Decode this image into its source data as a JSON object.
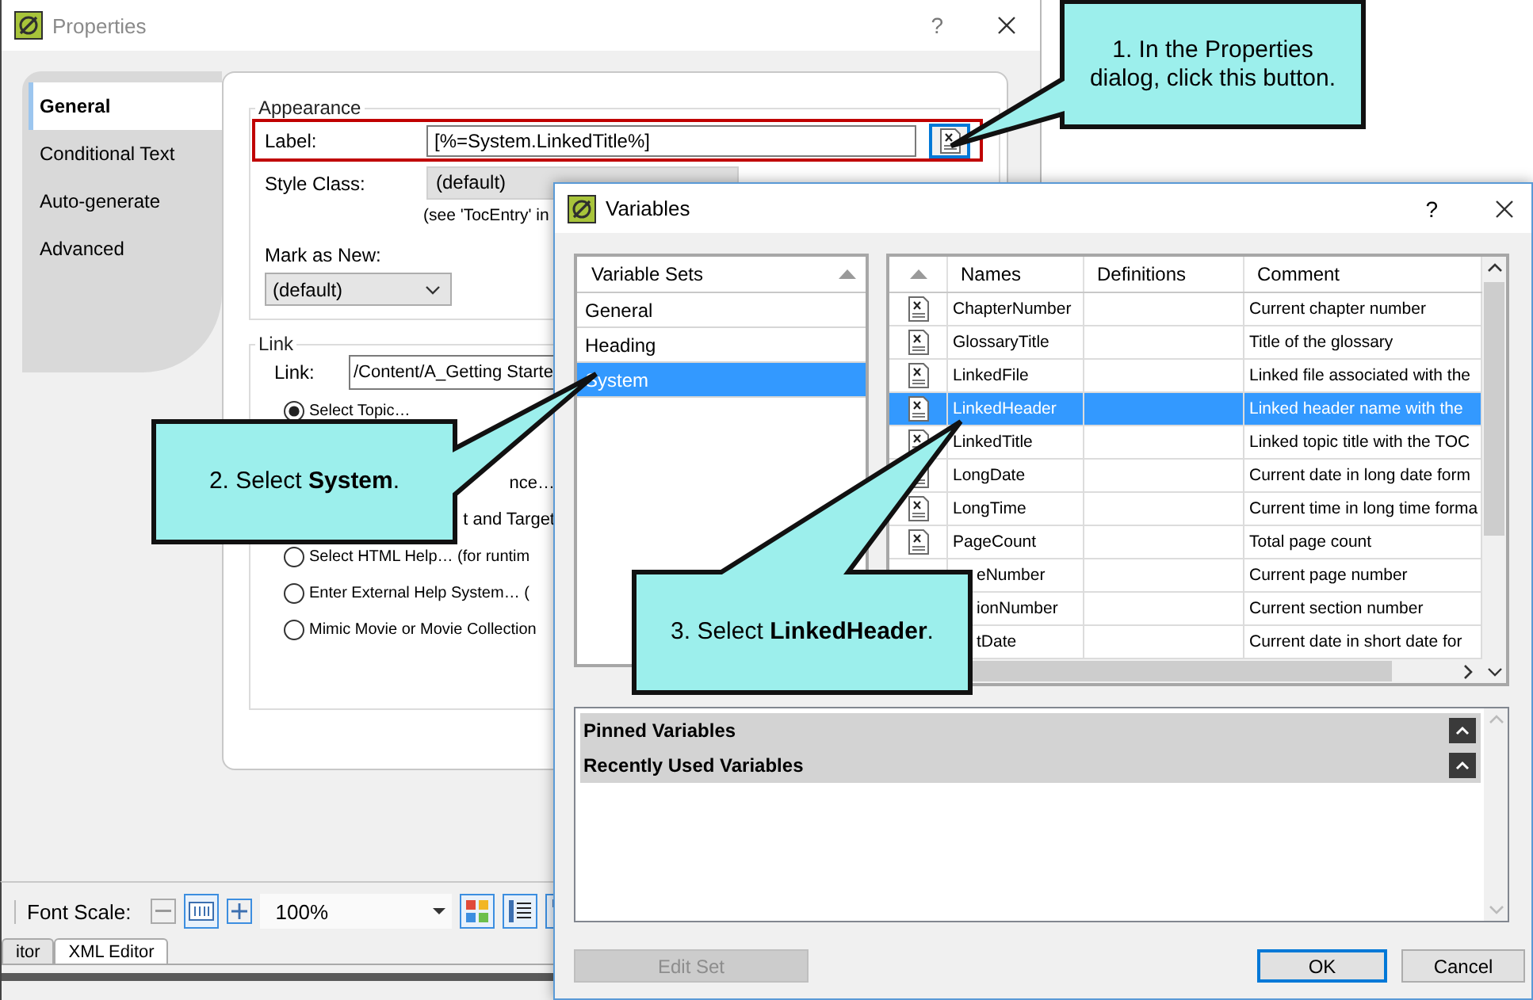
{
  "properties_window": {
    "title": "Properties",
    "help": "?",
    "tabs": [
      {
        "label": "General",
        "selected": true
      },
      {
        "label": "Conditional Text",
        "selected": false
      },
      {
        "label": "Auto-generate",
        "selected": false
      },
      {
        "label": "Advanced",
        "selected": false
      }
    ],
    "appearance": {
      "legend": "Appearance",
      "label": "Label:",
      "label_value": "[%=System.LinkedTitle%]",
      "style_class_label": "Style Class:",
      "style_class_value": "(default)",
      "style_class_note": "(see 'TocEntry' in",
      "mark_as_new_label": "Mark as New:",
      "mark_as_new_value": "(default)"
    },
    "link": {
      "legend": "Link",
      "label": "Link:",
      "value": "/Content/A_Getting Starte",
      "options": [
        {
          "kind": "radio",
          "label": "Select Topic…",
          "selected": true
        },
        {
          "kind": "fragment",
          "label": "nce…"
        },
        {
          "kind": "fragment",
          "label": "t and Target"
        },
        {
          "kind": "radio",
          "label": "Select HTML Help… (for runtim",
          "selected": false
        },
        {
          "kind": "radio",
          "label": "Enter External Help System… (",
          "selected": false
        },
        {
          "kind": "radio",
          "label": "Mimic Movie or Movie Collection",
          "selected": false
        }
      ]
    }
  },
  "editor_toolbar": {
    "font_scale_label": "Font Scale:",
    "zoom_value": "100%",
    "tabs": [
      {
        "label": "itor",
        "selected": false
      },
      {
        "label": "XML Editor",
        "selected": true
      }
    ]
  },
  "variables_window": {
    "title": "Variables",
    "help": "?",
    "sets_header": "Variable Sets",
    "sets": [
      {
        "label": "General",
        "selected": false
      },
      {
        "label": "Heading",
        "selected": false
      },
      {
        "label": "System",
        "selected": true
      }
    ],
    "columns": [
      "Names",
      "Definitions",
      "Comment"
    ],
    "rows": [
      {
        "kind": "full",
        "name": "ChapterNumber",
        "comment": "Current chapter number",
        "selected": false
      },
      {
        "kind": "full",
        "name": "GlossaryTitle",
        "comment": "Title of the glossary",
        "selected": false
      },
      {
        "kind": "full",
        "name": "LinkedFile",
        "comment": "Linked file associated with the",
        "selected": false
      },
      {
        "kind": "full",
        "name": "LinkedHeader",
        "comment": "Linked header name with the",
        "selected": true
      },
      {
        "kind": "full",
        "name": "LinkedTitle",
        "comment": "Linked topic title with the TOC",
        "selected": false
      },
      {
        "kind": "full",
        "name": "LongDate",
        "comment": "Current date in long date form",
        "selected": false
      },
      {
        "kind": "full",
        "name": "LongTime",
        "comment": "Current time in long time forma",
        "selected": false
      },
      {
        "kind": "full",
        "name": "PageCount",
        "comment": "Total page count",
        "selected": false
      },
      {
        "kind": "partial",
        "name": "eNumber",
        "comment": "Current page number",
        "selected": false
      },
      {
        "kind": "partial",
        "name": "ionNumber",
        "comment": "Current section number",
        "selected": false
      },
      {
        "kind": "partial",
        "name": "tDate",
        "comment": "Current date in short date for",
        "selected": false
      }
    ],
    "panels": [
      {
        "title": "Pinned Variables"
      },
      {
        "title": "Recently Used Variables"
      }
    ],
    "buttons": [
      {
        "label": "Edit Set",
        "disabled": true,
        "default": false
      },
      {
        "label": "OK",
        "disabled": false,
        "default": true
      },
      {
        "label": "Cancel",
        "disabled": false,
        "default": false
      }
    ]
  },
  "callouts": [
    {
      "text": "1. In the Properties dialog, click this button."
    },
    {
      "text": "2. Select **System**."
    },
    {
      "text": "3. Select **LinkedHeader**."
    }
  ]
}
